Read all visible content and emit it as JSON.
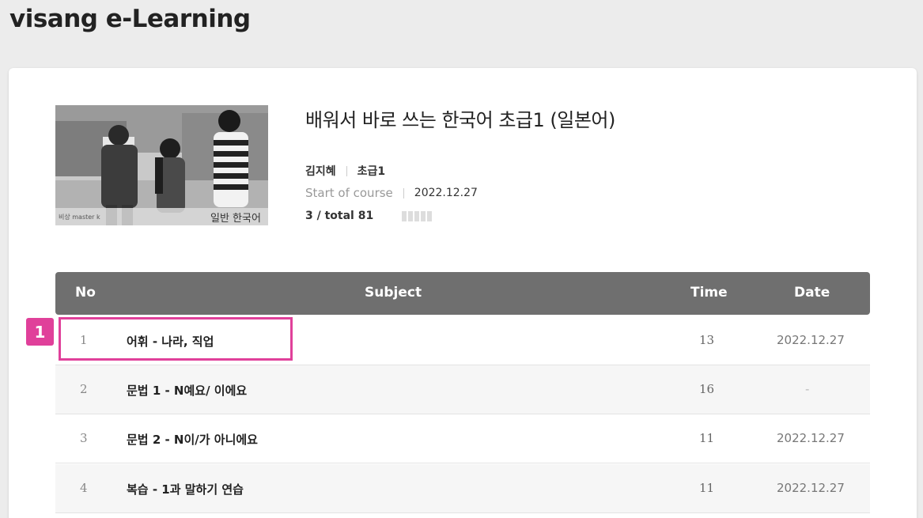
{
  "app": {
    "title": "visang e-Learning"
  },
  "course": {
    "title": "배워서 바로 쓰는 한국어 초급1 (일본어)",
    "instructor": "김지혜",
    "level": "초급1",
    "start_label": "Start of course",
    "start_date": "2022.12.27",
    "progress_text": "3 / total 81",
    "thumbnail_caption": "일반 한국어",
    "thumbnail_logo": "비상 master k"
  },
  "table": {
    "headers": {
      "no": "No",
      "subject": "Subject",
      "time": "Time",
      "date": "Date"
    },
    "rows": [
      {
        "no": "1",
        "subject": "어휘 - 나라, 직업",
        "time": "13",
        "date": "2022.12.27"
      },
      {
        "no": "2",
        "subject": "문법 1 - N예요/ 이에요",
        "time": "16",
        "date": "-"
      },
      {
        "no": "3",
        "subject": "문법 2 - N이/가 아니에요",
        "time": "11",
        "date": "2022.12.27"
      },
      {
        "no": "4",
        "subject": "복습 - 1과 말하기 연습",
        "time": "11",
        "date": "2022.12.27"
      }
    ]
  },
  "annotation": {
    "step": "1"
  },
  "colors": {
    "accent": "#e0409a",
    "header_bg": "#6f6f6f"
  }
}
